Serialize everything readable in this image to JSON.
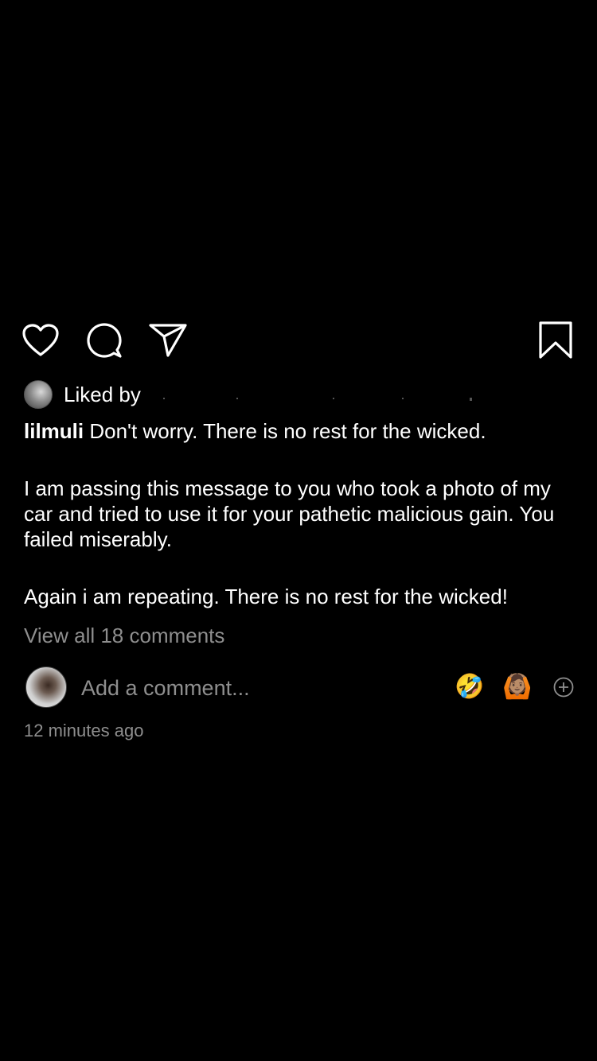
{
  "post": {
    "liked_by_label": "Liked by",
    "username": "lilmuli",
    "caption_first": "Don't worry. There is no rest for the wicked.",
    "caption_second": "I am passing this message to you who took a photo of my car and tried to use it for your pathetic malicious gain. You failed miserably.",
    "caption_third": "Again i am repeating. There is no rest for the wicked!",
    "view_comments": "View all 18 comments",
    "timestamp": "12 minutes ago"
  },
  "comment_box": {
    "placeholder": "Add a comment...",
    "quick_emojis": [
      "🤣",
      "🙆🏽"
    ]
  },
  "icons": {
    "like": "heart-icon",
    "comment": "comment-bubble-icon",
    "share": "paper-plane-icon",
    "save": "bookmark-icon",
    "add": "plus-circle-icon"
  },
  "colors": {
    "background": "#000000",
    "text": "#ffffff",
    "muted": "#8e8e8e"
  }
}
